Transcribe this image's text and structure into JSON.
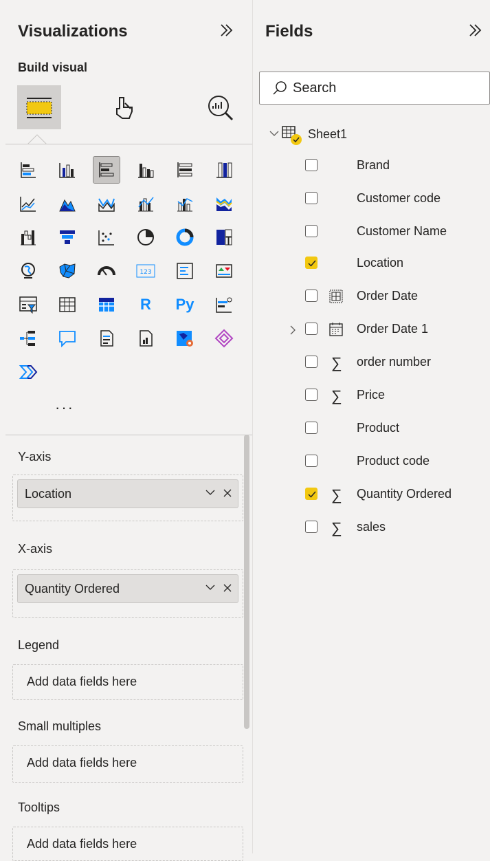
{
  "visualizations": {
    "title": "Visualizations",
    "build_visual_label": "Build visual",
    "more_label": "···",
    "tabs": [
      {
        "icon": "build-visual-icon",
        "active": true
      },
      {
        "icon": "format-visual-icon",
        "active": false
      },
      {
        "icon": "analytics-icon",
        "active": false
      }
    ],
    "gallery_selected": "clustered-bar-chart-icon",
    "wells": {
      "y_axis": {
        "label": "Y-axis",
        "value": "Location"
      },
      "x_axis": {
        "label": "X-axis",
        "value": "Quantity Ordered"
      },
      "legend": {
        "label": "Legend",
        "placeholder": "Add data fields here"
      },
      "small_multiples": {
        "label": "Small multiples",
        "placeholder": "Add data fields here"
      },
      "tooltips": {
        "label": "Tooltips",
        "placeholder": "Add data fields here"
      }
    }
  },
  "fields": {
    "title": "Fields",
    "search_placeholder": "Search",
    "table_name": "Sheet1",
    "items": [
      {
        "label": "Brand",
        "checked": false,
        "type": "text"
      },
      {
        "label": "Customer code",
        "checked": false,
        "type": "text"
      },
      {
        "label": "Customer Name",
        "checked": false,
        "type": "text"
      },
      {
        "label": "Location",
        "checked": true,
        "type": "text"
      },
      {
        "label": "Order Date",
        "checked": false,
        "type": "date"
      },
      {
        "label": "Order Date 1",
        "checked": false,
        "type": "hierarchy"
      },
      {
        "label": "order number",
        "checked": false,
        "type": "sum"
      },
      {
        "label": "Price",
        "checked": false,
        "type": "sum"
      },
      {
        "label": "Product",
        "checked": false,
        "type": "text"
      },
      {
        "label": "Product code",
        "checked": false,
        "type": "text"
      },
      {
        "label": "Quantity Ordered",
        "checked": true,
        "type": "sum"
      },
      {
        "label": "sales",
        "checked": false,
        "type": "sum"
      }
    ]
  },
  "colors": {
    "accent": "#f2c811",
    "selected_bg": "#c8c6c4",
    "chart_blue": "#118dff",
    "chart_dark": "#12239e"
  }
}
